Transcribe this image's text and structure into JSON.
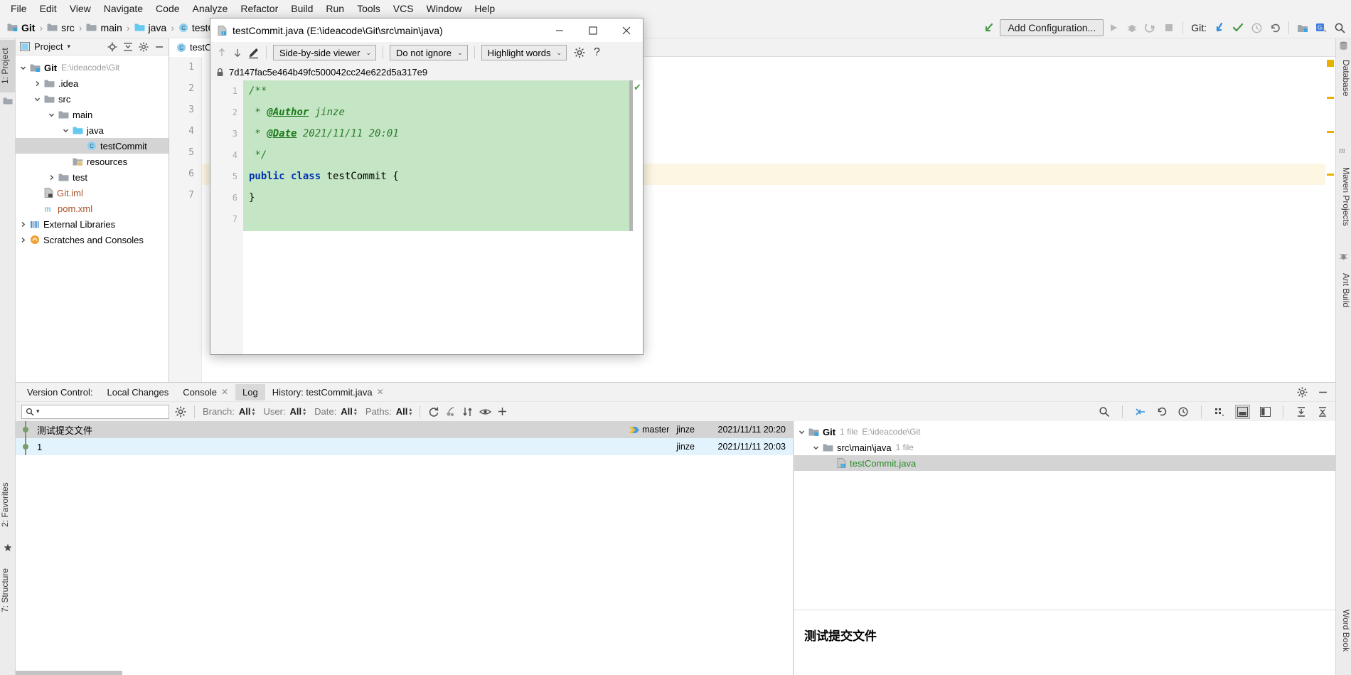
{
  "menubar": {
    "items": [
      "File",
      "Edit",
      "View",
      "Navigate",
      "Code",
      "Analyze",
      "Refactor",
      "Build",
      "Run",
      "Tools",
      "VCS",
      "Window",
      "Help"
    ]
  },
  "navbar": {
    "breadcrumbs": [
      {
        "label": "Git",
        "icon": "module-icon",
        "bold": true
      },
      {
        "label": "src",
        "icon": "folder-icon",
        "bold": false
      },
      {
        "label": "main",
        "icon": "folder-icon",
        "bold": false
      },
      {
        "label": "java",
        "icon": "source-folder-icon",
        "bold": false
      },
      {
        "label": "testCommit",
        "icon": "class-icon",
        "bold": false
      }
    ],
    "run_config": "Add Configuration...",
    "git_label": "Git:",
    "icons": [
      "back-arrow-icon",
      "run-icon",
      "debug-icon",
      "coverage-icon",
      "stop-icon",
      "update-project-icon",
      "commit-icon",
      "history-icon",
      "rollback-icon",
      "project-structure-icon",
      "translate-icon",
      "search-everywhere-icon"
    ]
  },
  "left_tool_tabs": [
    {
      "label": "1: Project",
      "selected": true
    },
    {
      "label": "2: Favorites",
      "selected": false
    },
    {
      "label": "7: Structure",
      "selected": false
    }
  ],
  "right_tool_tabs": [
    {
      "label": "Database"
    },
    {
      "label": "Maven Projects"
    },
    {
      "label": "Ant Build"
    },
    {
      "label": "Word Book"
    }
  ],
  "project_panel": {
    "title": "Project",
    "header_icons": [
      "locate-icon",
      "collapse-all-icon",
      "gear-icon",
      "hide-icon"
    ],
    "tree": [
      {
        "depth": 0,
        "arrow": "down",
        "icon": "module-icon",
        "label": "Git",
        "sub": "E:\\ideacode\\Git",
        "bold": true,
        "color": "#000000",
        "selected": false
      },
      {
        "depth": 1,
        "arrow": "right",
        "icon": "folder-icon",
        "label": ".idea",
        "sub": "",
        "bold": false,
        "color": "#000000",
        "selected": false
      },
      {
        "depth": 1,
        "arrow": "down",
        "icon": "folder-icon",
        "label": "src",
        "sub": "",
        "bold": false,
        "color": "#000000",
        "selected": false
      },
      {
        "depth": 2,
        "arrow": "down",
        "icon": "folder-icon",
        "label": "main",
        "sub": "",
        "bold": false,
        "color": "#000000",
        "selected": false
      },
      {
        "depth": 3,
        "arrow": "down",
        "icon": "source-folder-icon",
        "label": "java",
        "sub": "",
        "bold": false,
        "color": "#000000",
        "selected": false
      },
      {
        "depth": 4,
        "arrow": "none",
        "icon": "class-icon",
        "label": "testCommit",
        "sub": "",
        "bold": false,
        "color": "#000000",
        "selected": true
      },
      {
        "depth": 3,
        "arrow": "none",
        "icon": "resources-folder-icon",
        "label": "resources",
        "sub": "",
        "bold": false,
        "color": "#000000",
        "selected": false
      },
      {
        "depth": 2,
        "arrow": "right",
        "icon": "folder-icon",
        "label": "test",
        "sub": "",
        "bold": false,
        "color": "#000000",
        "selected": false
      },
      {
        "depth": 1,
        "arrow": "none",
        "icon": "iml-file-icon",
        "label": "Git.iml",
        "sub": "",
        "bold": false,
        "color": "#a9522a",
        "selected": false
      },
      {
        "depth": 1,
        "arrow": "none",
        "icon": "maven-xml-icon",
        "label": "pom.xml",
        "sub": "",
        "bold": false,
        "color": "#a9522a",
        "selected": false
      },
      {
        "depth": 0,
        "arrow": "right",
        "icon": "external-libraries-icon",
        "label": "External Libraries",
        "sub": "",
        "bold": false,
        "color": "#000000",
        "selected": false
      },
      {
        "depth": 0,
        "arrow": "right",
        "icon": "scratches-icon",
        "label": "Scratches and Consoles",
        "sub": "",
        "bold": false,
        "color": "#000000",
        "selected": false
      }
    ]
  },
  "editor": {
    "tab_label": "testCommit",
    "gutter_numbers": [
      "1",
      "2",
      "3",
      "4",
      "5",
      "6",
      "7"
    ],
    "highlight_line": 6
  },
  "dialog": {
    "title": "testCommit.java (E:\\ideacode\\Git\\src\\main\\java)",
    "window_buttons": [
      "minimize",
      "maximize",
      "close"
    ],
    "toolbar": {
      "prev_label": "previous-difference",
      "next_label": "next-difference",
      "edit_label": "edit-source",
      "viewer_mode": "Side-by-side viewer",
      "whitespace_mode": "Do not ignore",
      "highlight_mode": "Highlight words",
      "settings_label": "settings",
      "help_label": "help"
    },
    "commit_hash": "7d147fac5e464b49fc500042cc24e622d5a317e9",
    "line_numbers": [
      "1",
      "2",
      "3",
      "4",
      "5",
      "6",
      "7"
    ],
    "code_lines": [
      {
        "n": "1",
        "segments": [
          {
            "t": "/**",
            "c": "cm"
          }
        ]
      },
      {
        "n": "2",
        "segments": [
          {
            "t": " * ",
            "c": "cm"
          },
          {
            "t": "@Author",
            "c": "cmtag"
          },
          {
            "t": " jinze",
            "c": "cm"
          }
        ]
      },
      {
        "n": "3",
        "segments": [
          {
            "t": " * ",
            "c": "cm"
          },
          {
            "t": "@Date",
            "c": "cmtag"
          },
          {
            "t": " 2021/11/11 20:01",
            "c": "cm"
          }
        ]
      },
      {
        "n": "4",
        "segments": [
          {
            "t": " */",
            "c": "cm"
          }
        ]
      },
      {
        "n": "5",
        "segments": [
          {
            "t": "public class ",
            "c": "kw"
          },
          {
            "t": "testCommit {",
            "c": "pl"
          }
        ]
      },
      {
        "n": "6",
        "segments": [
          {
            "t": "}",
            "c": "pl"
          }
        ]
      },
      {
        "n": "7",
        "segments": [
          {
            "t": "",
            "c": "pl"
          }
        ]
      }
    ]
  },
  "vcs": {
    "panel_label": "Version Control:",
    "tabs": [
      {
        "label": "Local Changes",
        "closable": false,
        "selected": false
      },
      {
        "label": "Console",
        "closable": true,
        "selected": false
      },
      {
        "label": "Log",
        "closable": false,
        "selected": true
      },
      {
        "label": "History: testCommit.java",
        "closable": true,
        "selected": false
      }
    ],
    "header_icons": [
      "gear-icon",
      "hide-icon"
    ],
    "search_placeholder": "",
    "filters": [
      {
        "name": "Branch:",
        "value": "All"
      },
      {
        "name": "User:",
        "value": "All"
      },
      {
        "name": "Date:",
        "value": "All"
      },
      {
        "name": "Paths:",
        "value": "All"
      }
    ],
    "toolbar_icons": [
      "refresh-icon",
      "cherry-pick-icon",
      "sort-icon",
      "eye-icon",
      "add-icon"
    ],
    "right_icons": [
      "search-icon",
      "collapse-branch-icon",
      "revert-icon",
      "history-icon",
      "grid-icon",
      "bottom-layout-icon",
      "side-layout-icon",
      "expand-icon",
      "collapse-icon"
    ],
    "commits": [
      {
        "subject": "测试提交文件",
        "branch": "master",
        "author": "jinze",
        "date": "2021/11/11 20:20",
        "selected": true
      },
      {
        "subject": "1",
        "branch": "",
        "author": "jinze",
        "date": "2021/11/11 20:03",
        "selected": false
      }
    ],
    "details": {
      "tree": [
        {
          "depth": 0,
          "arrow": "down",
          "icon": "module-icon",
          "label": "Git",
          "count": "1 file",
          "path": "E:\\ideacode\\Git",
          "color": "#000000",
          "bold": true,
          "selected": false
        },
        {
          "depth": 1,
          "arrow": "down",
          "icon": "folder-icon",
          "label": "src\\main\\java",
          "count": "1 file",
          "path": "",
          "color": "#000000",
          "bold": false,
          "selected": false
        },
        {
          "depth": 2,
          "arrow": "none",
          "icon": "java-file-icon",
          "label": "testCommit.java",
          "count": "",
          "path": "",
          "color": "#2a8a2a",
          "bold": false,
          "selected": true
        }
      ],
      "commit_message": "测试提交文件"
    }
  }
}
